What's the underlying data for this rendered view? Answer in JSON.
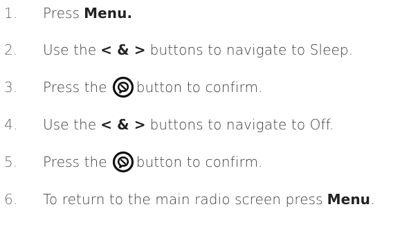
{
  "steps": [
    {
      "num": "1.",
      "parts": {
        "a": "Press",
        "b": "Menu."
      }
    },
    {
      "num": "2.",
      "parts": {
        "a": "Use the",
        "b": "< & >",
        "c": "buttons to navigate to Sleep."
      }
    },
    {
      "num": "3.",
      "parts": {
        "a": "Press the",
        "c": "button to confirm."
      },
      "icon": "confirm-button-icon"
    },
    {
      "num": "4.",
      "parts": {
        "a": "Use the",
        "b": "< & >",
        "c": "buttons to navigate to Off."
      }
    },
    {
      "num": "5.",
      "parts": {
        "a": "Press the",
        "c": "button to confirm."
      },
      "icon": "confirm-button-icon"
    },
    {
      "num": "6.",
      "parts": {
        "a": "To return to the main radio screen press",
        "b": "Menu",
        "c": "."
      }
    }
  ]
}
